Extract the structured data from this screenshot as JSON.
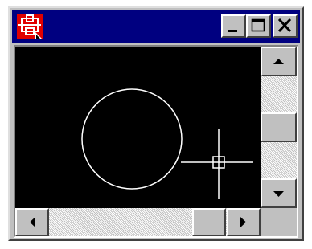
{
  "window": {
    "title_icon": "app-icon",
    "controls": [
      {
        "name": "minimize-button",
        "icon": "minimize-icon"
      },
      {
        "name": "maximize-button",
        "icon": "maximize-icon"
      },
      {
        "name": "close-button",
        "icon": "close-icon"
      }
    ]
  },
  "canvas": {
    "background": "#000000",
    "stroke": "#ffffff",
    "shapes": [
      "circle",
      "crosshair-cursor"
    ]
  },
  "scrollbars": {
    "vertical": {
      "up_icon": "arrow-up-icon",
      "down_icon": "arrow-down-icon",
      "position": 0.5
    },
    "horizontal": {
      "left_icon": "arrow-left-icon",
      "right_icon": "arrow-right-icon",
      "position": 0.8
    }
  },
  "colors": {
    "titlebar": "#000080",
    "face": "#c0c0c0",
    "icon_red": "#e00000"
  }
}
